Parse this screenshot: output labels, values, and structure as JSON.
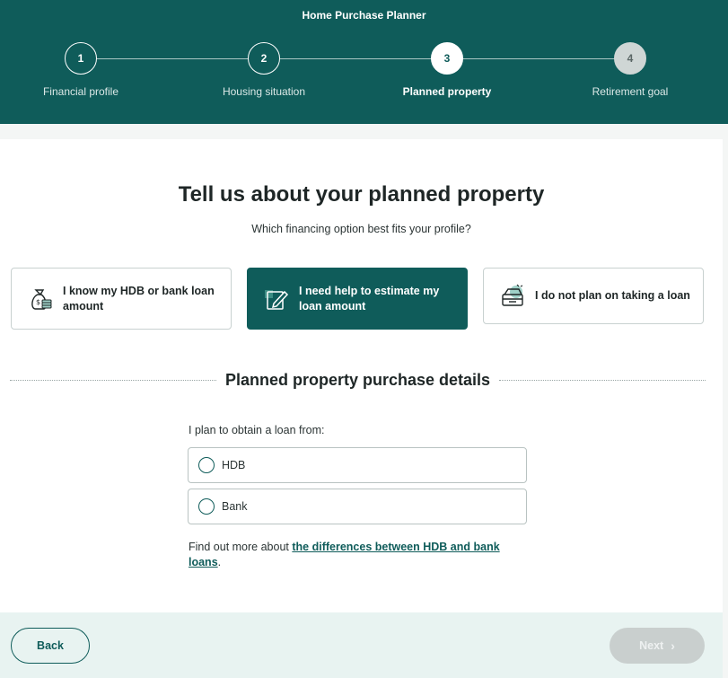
{
  "header": {
    "title": "Home Purchase Planner",
    "steps": [
      {
        "number": "1",
        "label": "Financial profile",
        "state": "done"
      },
      {
        "number": "2",
        "label": "Housing situation",
        "state": "done"
      },
      {
        "number": "3",
        "label": "Planned property",
        "state": "active"
      },
      {
        "number": "4",
        "label": "Retirement goal",
        "state": "todo"
      }
    ]
  },
  "main": {
    "title": "Tell us about your planned property",
    "subtitle": "Which financing option best fits your profile?",
    "options": [
      {
        "label": "I know my HDB or bank loan amount",
        "icon": "money-bag-icon",
        "selected": false
      },
      {
        "label": "I need help to estimate my loan amount",
        "icon": "edit-note-icon",
        "selected": true
      },
      {
        "label": "I do not plan on taking a loan",
        "icon": "cash-box-icon",
        "selected": false
      }
    ],
    "section_title": "Planned property purchase details",
    "loan_question": "I plan to obtain a loan from:",
    "loan_sources": [
      {
        "label": "HDB",
        "checked": false
      },
      {
        "label": "Bank",
        "checked": false
      }
    ],
    "info_prefix": "Find out more about ",
    "info_link": "the differences between HDB and bank loans",
    "info_suffix": "."
  },
  "footer": {
    "back_label": "Back",
    "next_label": "Next",
    "next_enabled": false
  },
  "colors": {
    "brand": "#0f5c5a",
    "footer_bg": "#e8f3f1",
    "disabled": "#c9cfce"
  }
}
